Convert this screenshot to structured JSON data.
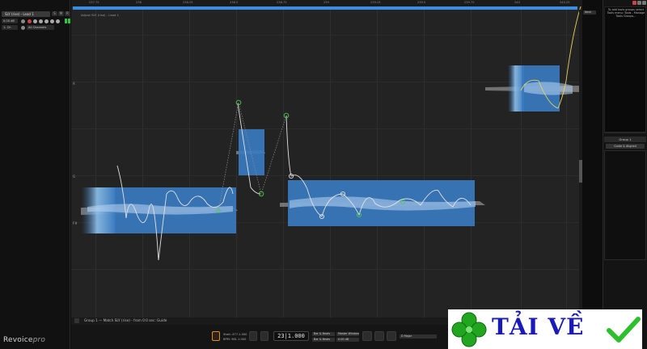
{
  "app": {
    "name_main": "Revoice",
    "name_suffix": "pro"
  },
  "track": {
    "name": "SLY (rise) - Lead 1",
    "level": "0.00 dB",
    "mode": "1- Ch",
    "channel_select": "All Channels",
    "button_labels": [
      "S",
      "M",
      "R",
      "I"
    ]
  },
  "ruler": {
    "labels": [
      "237.75",
      "238",
      "238.25",
      "238.5",
      "238.75",
      "239",
      "239.25",
      "239.5",
      "239.75",
      "240",
      "240.25"
    ]
  },
  "edit": {
    "guide_label": "Adjust SLY (rise) - Lead 1",
    "note_labels": [
      "A",
      "G",
      "F#"
    ]
  },
  "clip": {
    "label": "Group 1 — Match SLY (rise) - from 0:0 sec: Guide"
  },
  "right_panel": {
    "hint": "To add tools groups select Tools menu: Tools - Manage Tools Groups...",
    "group_title": "Group 1",
    "group_mode": "Guide & Aligned",
    "top_button": "Next"
  },
  "transport": {
    "counter": "23|1.000",
    "start_label": "Start: 477.1.000",
    "bpm_label": "BPM: 961.1.000",
    "drop_a1": "Bar & Beats",
    "drop_a2": "Bar & Beats",
    "drop_b1": "Master Window",
    "drop_b2": "0.00 dB",
    "drop_c": "D Major"
  },
  "colors": {
    "accent_blue": "#3b8de0",
    "clip_blue": "#3a79bf",
    "pitch_green": "#4ccc4c",
    "pitch_yellow": "#e8d35a",
    "watermark_text": "#1a1ab8",
    "watermark_check": "#2dbf2d"
  },
  "watermark": {
    "text": "TẢI VỀ"
  }
}
